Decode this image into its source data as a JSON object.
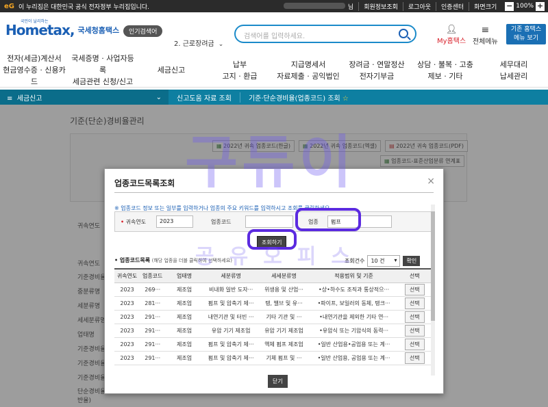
{
  "topbar": {
    "eg_logo": "eG",
    "gov_notice": "이 누리집은 대한민국 공식 전자정부 누리집입니다.",
    "user_suffix": "님",
    "links": [
      "회원정보조회",
      "로그아웃",
      "인증센터",
      "화면크기"
    ],
    "zoom_minus": "−",
    "zoom_value": "100%",
    "zoom_plus": "+"
  },
  "header": {
    "logo_tagline": "국민이 날리하는",
    "logo_main": "Hometax,",
    "logo_sub": "국세청홈택스",
    "popular_label": "인기검색어",
    "popular_item": "2. 근로장려금",
    "search_placeholder": "검색어를 입력하세요.",
    "my_hometax": "My홈택스",
    "menu_all": "전체메뉴",
    "base_button": [
      "기존 홈택스",
      "메뉴 보기"
    ]
  },
  "nav": [
    [
      "전자(세금)계산서",
      "현금영수증 · 신용카드"
    ],
    [
      "국세증명 · 사업자등록",
      "세금관련 신청/신고"
    ],
    [
      "세금신고"
    ],
    [
      "납부",
      "고지 · 환급"
    ],
    [
      "지급명세서",
      "자료제출 · 공익법인"
    ],
    [
      "장려금 · 연말정산",
      "전자기부금"
    ],
    [
      "상담 · 불복 · 고충",
      "제보 · 기타"
    ],
    [
      "세무대리",
      "납세관리"
    ]
  ],
  "crumb": {
    "menu": "세금신고",
    "level2": "신고도움 자료 조회",
    "level3": "기준·단순경비율(업종코드) 조회"
  },
  "page": {
    "title": "기준(단순)경비율관리",
    "downloads": [
      "2022년 귀속 업종코드(한글)",
      "2022년 귀속 업종코드(엑셀)",
      "2022년 귀속 업종코드(PDF)",
      "업종코드-표준산업분류 연계표"
    ],
    "side_labels": [
      "귀속연도",
      "귀속연도",
      "기준경비율",
      "중분류명",
      "세분류명",
      "세세분류명",
      "업태명",
      "기준경비율",
      "기준경비율",
      "기준경비율",
      "단순경비율",
      "단순경비율",
      "단순경비율(일반율)"
    ]
  },
  "modal": {
    "title": "업종코드목록조회",
    "close_glyph": "×",
    "note": "※ 업종코드 정보 또는 일부를 입력하거나 업종의 주요 키워드를 입력하시고 조회를 클릭하세요",
    "year_label": "귀속연도",
    "year_value": "2023",
    "code_label": "업종코드",
    "code_value": "",
    "biz_label": "업종",
    "biz_value": "펌프",
    "search_button": "조회하기",
    "list_title": "업종코드목록",
    "list_sub": "(해당 업종을 더블 클릭하여 선택하세요)",
    "count_label": "조회건수",
    "count_value": "10 건",
    "ok_button": "확인",
    "close_button": "닫기",
    "columns": [
      "귀속연도",
      "업종코드",
      "업태명",
      "세분류명",
      "세세분류명",
      "적용범위 및 기준",
      "선택"
    ],
    "rows": [
      [
        "2023",
        "269···",
        "제조업",
        "비내화 일반 도자···",
        "위생용 및 산업···",
        "•상•하수도 조직과 통상적으···",
        "선택"
      ],
      [
        "2023",
        "281···",
        "제조업",
        "펌프 및 압축기 제···",
        "탱, 밸브 및 유···",
        "•파이프, 보일러의 동체, 탱크···",
        "선택"
      ],
      [
        "2023",
        "291···",
        "제조업",
        "내연기관 및 터빈 ···",
        "기타 기관 및 ···",
        "•내연기관을 제외한 기타 연···",
        "선택"
      ],
      [
        "2023",
        "291···",
        "제조업",
        "유압 기기 제조업",
        "유압 기기 제조업",
        "•유압식 또는 기압식의 동력···",
        "선택"
      ],
      [
        "2023",
        "291···",
        "제조업",
        "펌프 및 압축기 제···",
        "액체 펌프 제조업",
        "•일반 산업용•공업용 또는 계···",
        "선택"
      ],
      [
        "2023",
        "291···",
        "제조업",
        "펌프 및 압축기 제···",
        "기체 펌프 및 ···",
        "•일반 산업용, 공업용 또는 계···",
        "선택"
      ]
    ]
  },
  "watermark": {
    "big": "구듀이",
    "small": "공유오피스"
  },
  "colors": {
    "accent": "#1a5fb4",
    "crumb_bar": "#0e7fa1",
    "highlight": "#5b2ae0"
  }
}
